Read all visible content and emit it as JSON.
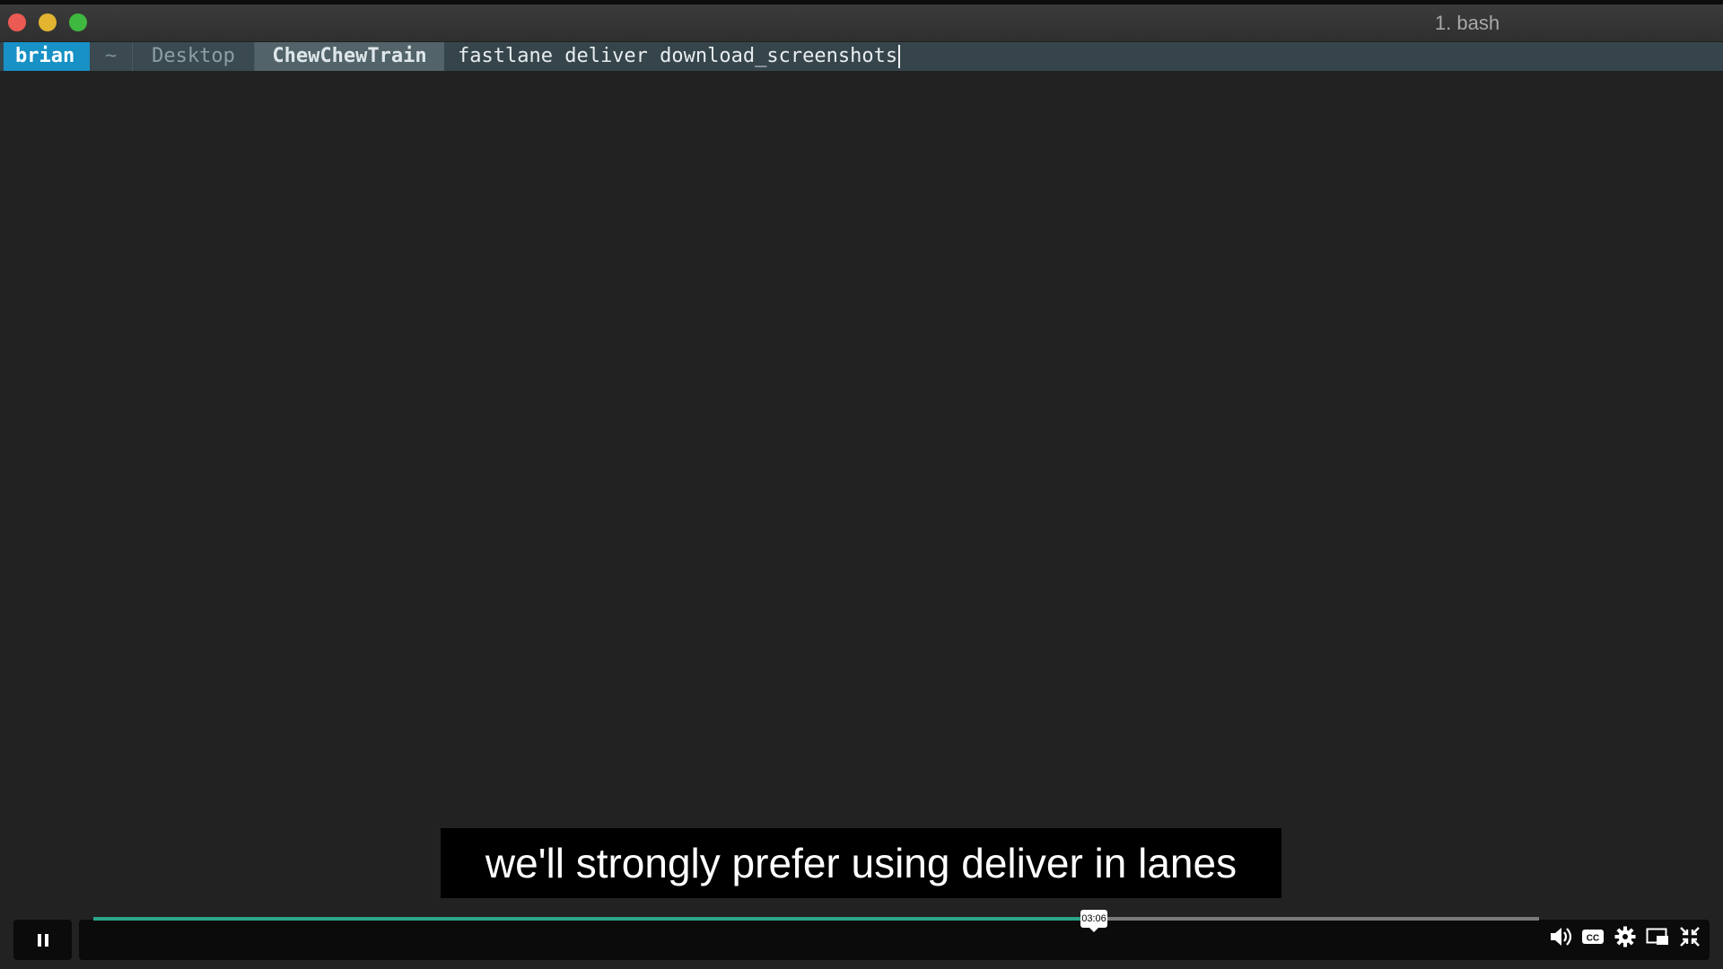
{
  "window": {
    "title": "1. bash"
  },
  "prompt": {
    "user": "brian",
    "home": "~",
    "dir1": "Desktop",
    "dir2": "ChewChewTrain",
    "command": "fastlane deliver download_screenshots"
  },
  "caption": "we'll strongly prefer using deliver in lanes",
  "player": {
    "time_tooltip": "03:06",
    "progress": 0.69,
    "icons": [
      "pause-icon",
      "volume-icon",
      "cc-icon",
      "settings-icon",
      "pip-icon",
      "exit-fullscreen-icon"
    ],
    "accent": "#2ba58a"
  }
}
